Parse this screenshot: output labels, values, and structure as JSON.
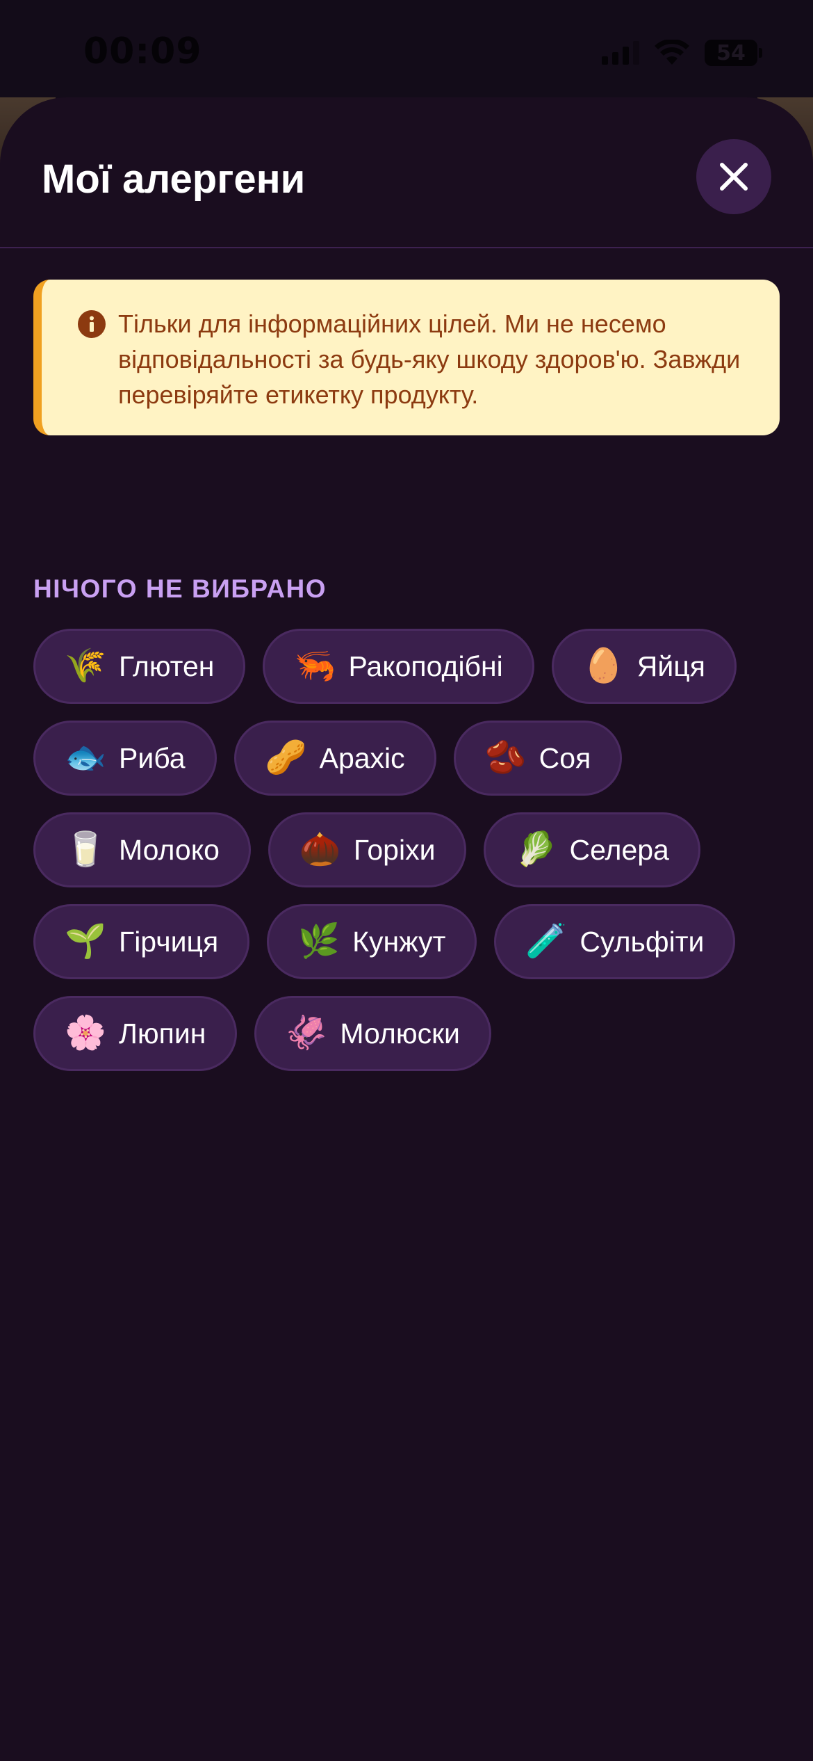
{
  "status_bar": {
    "time": "00:09",
    "battery": "54"
  },
  "sheet": {
    "title": "Мої алергени",
    "close_icon": "close-icon"
  },
  "disclaimer": {
    "icon": "info-icon",
    "text": "Тільки для інформаційних цілей. Ми не несемо відповідальності за будь-яку шкоду здоров'ю. Завжди перевіряйте етикетку продукту.",
    "accent_color": "#f0a021",
    "background_color": "#fff3c4"
  },
  "selection": {
    "label": "НІЧОГО НЕ ВИБРАНО"
  },
  "allergens": [
    {
      "icon": "🌾",
      "icon_name": "sheaf-of-rice-icon",
      "label": "Глютен"
    },
    {
      "icon": "🦐",
      "icon_name": "shrimp-icon",
      "label": "Ракоподібні"
    },
    {
      "icon": "🥚",
      "icon_name": "egg-icon",
      "label": "Яйця"
    },
    {
      "icon": "🐟",
      "icon_name": "fish-icon",
      "label": "Риба"
    },
    {
      "icon": "🥜",
      "icon_name": "peanut-icon",
      "label": "Арахіс"
    },
    {
      "icon": "🫘",
      "icon_name": "beans-icon",
      "label": "Соя"
    },
    {
      "icon": "🥛",
      "icon_name": "milk-glass-icon",
      "label": "Молоко"
    },
    {
      "icon": "🌰",
      "icon_name": "chestnut-icon",
      "label": "Горіхи"
    },
    {
      "icon": "🥬",
      "icon_name": "leafy-green-icon",
      "label": "Селера"
    },
    {
      "icon": "🌱",
      "icon_name": "seedling-icon",
      "label": "Гірчиця"
    },
    {
      "icon": "🌿",
      "icon_name": "herb-icon",
      "label": "Кунжут"
    },
    {
      "icon": "🧪",
      "icon_name": "test-tube-icon",
      "label": "Сульфіти"
    },
    {
      "icon": "🌸",
      "icon_name": "cherry-blossom-icon",
      "label": "Люпин"
    },
    {
      "icon": "🦑",
      "icon_name": "squid-icon",
      "label": "Молюски"
    }
  ],
  "colors": {
    "background": "#1a0d1f",
    "chip_background": "#3a1f4c",
    "section_label": "#c9a0f2",
    "disclaimer_text": "#8c3a10"
  }
}
